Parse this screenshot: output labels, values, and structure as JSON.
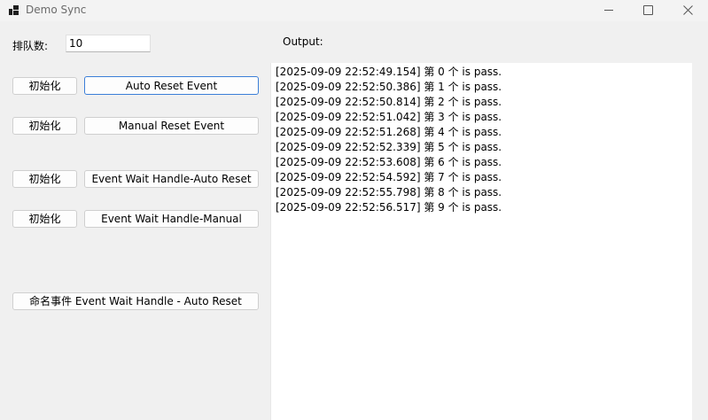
{
  "window": {
    "title": "Demo Sync",
    "icon": "app-grid-icon"
  },
  "form": {
    "queue_label": "排队数:",
    "queue_value": "10",
    "output_label": "Output:"
  },
  "buttons": {
    "init1": "初始化",
    "auto_reset": "Auto Reset Event",
    "init2": "初始化",
    "manual_reset": "Manual Reset Event",
    "init3": "初始化",
    "ewh_auto": "Event Wait Handle-Auto Reset",
    "init4": "初始化",
    "ewh_manual": "Event Wait Handle-Manual",
    "named": "命名事件 Event Wait Handle - Auto Reset"
  },
  "output_lines": [
    "[2025-09-09 22:52:49.154] 第 0 个 is pass.",
    "[2025-09-09 22:52:50.386] 第 1 个 is pass.",
    "[2025-09-09 22:52:50.814] 第 2 个 is pass.",
    "[2025-09-09 22:52:51.042] 第 3 个 is pass.",
    "[2025-09-09 22:52:51.268] 第 4 个 is pass.",
    "[2025-09-09 22:52:52.339] 第 5 个 is pass.",
    "[2025-09-09 22:52:53.608] 第 6 个 is pass.",
    "[2025-09-09 22:52:54.592] 第 7 个 is pass.",
    "[2025-09-09 22:52:55.798] 第 8 个 is pass.",
    "[2025-09-09 22:52:56.517] 第 9 个 is pass."
  ]
}
